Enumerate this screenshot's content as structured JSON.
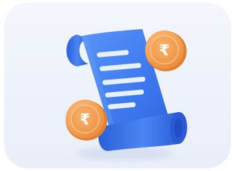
{
  "illustration": {
    "subject": "receipt-scroll-with-rupee-coins",
    "coin_symbol": "₹",
    "icons": [
      "receipt-scroll-icon",
      "rupee-coin-icon"
    ],
    "colors": {
      "tile_background": "#eef3fb",
      "scroll_blue": "#3f7cf0",
      "scroll_blue_dark": "#2457d6",
      "scroll_lines": "#eaf1ff",
      "coin_orange": "#f4a45a",
      "coin_rim": "#e8893a",
      "coin_symbol": "#ffffff"
    }
  }
}
